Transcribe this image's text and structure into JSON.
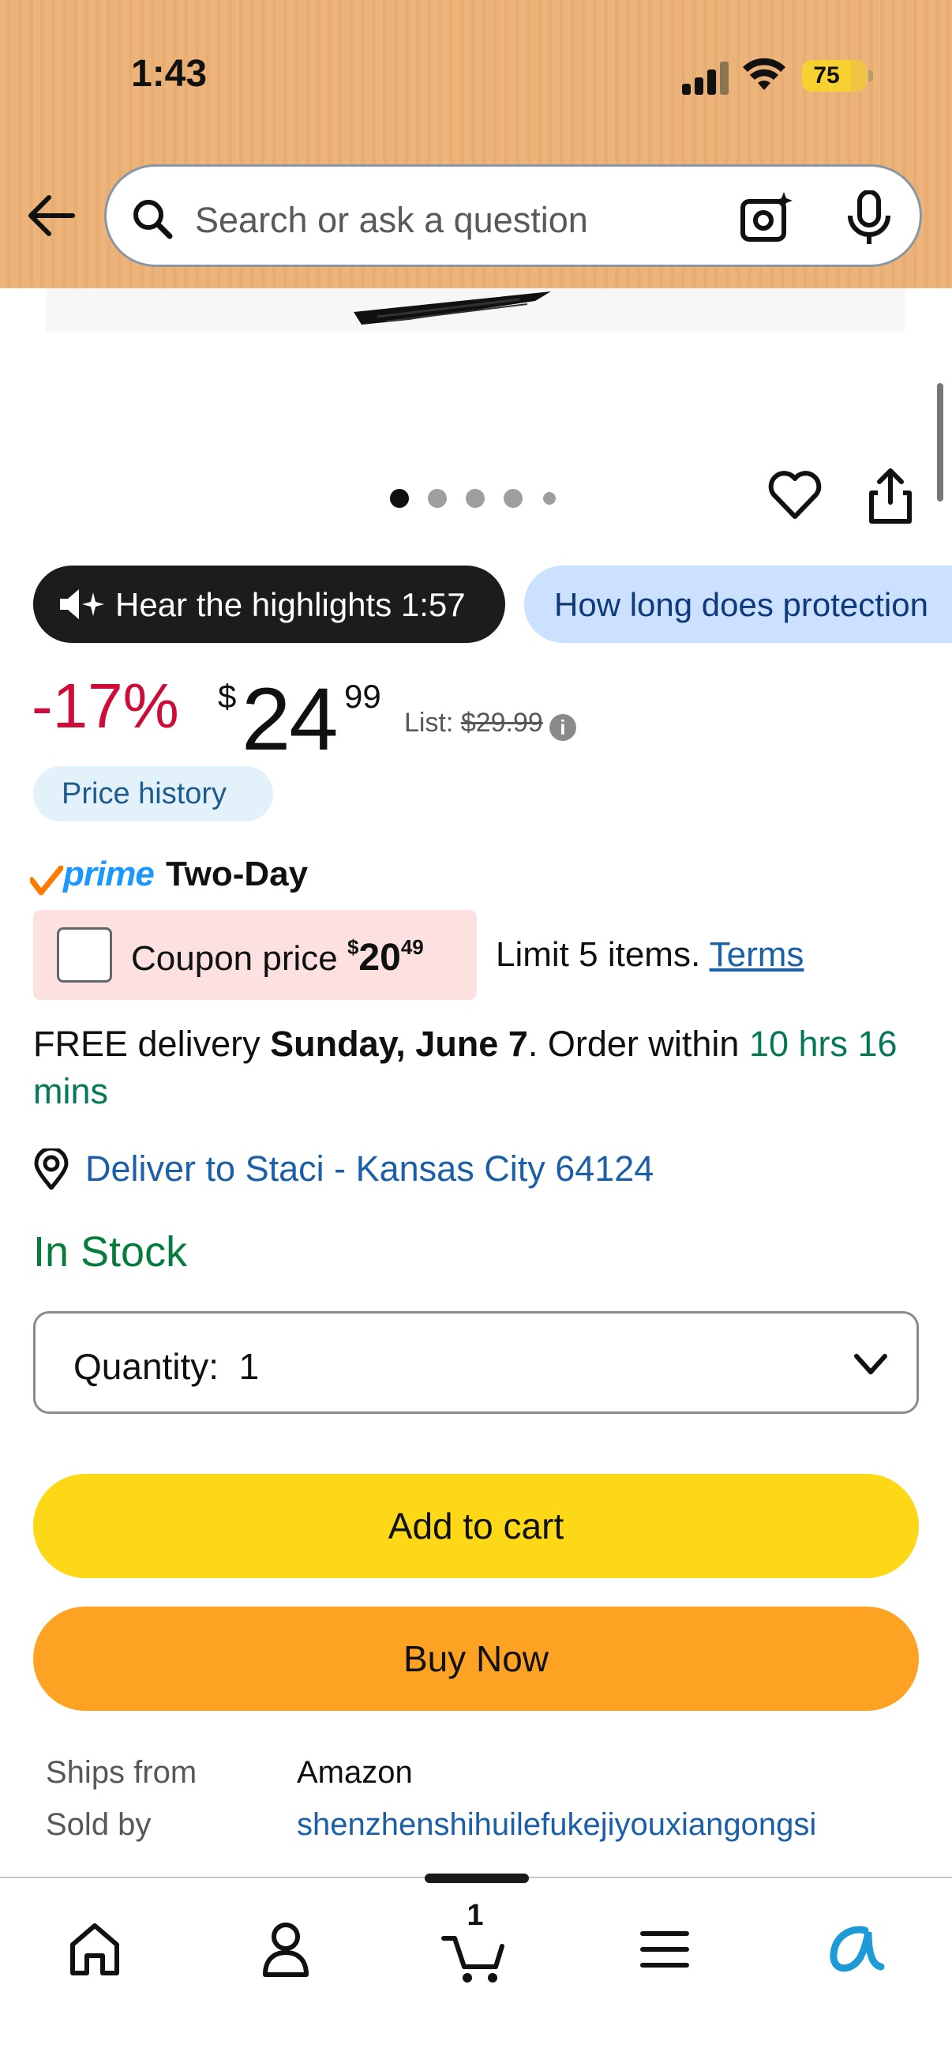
{
  "status_bar": {
    "time": "1:43",
    "battery": "75"
  },
  "search": {
    "placeholder": "Search or ask a question"
  },
  "gallery": {
    "dot_count": 5,
    "active_index": 0
  },
  "chips": {
    "hear": "Hear the highlights 1:57",
    "question": "How long does protection"
  },
  "price": {
    "discount": "-17%",
    "currency": "$",
    "whole": "24",
    "fraction": "99",
    "list_label": "List: ",
    "list_value": "$29.99"
  },
  "price_history": "Price history",
  "prime": {
    "word": "prime",
    "speed": "Two-Day"
  },
  "coupon": {
    "label": "Coupon price ",
    "currency": "$",
    "whole": "20",
    "fraction": "49",
    "limit": "Limit 5 items. ",
    "terms": "Terms"
  },
  "delivery": {
    "prefix": "FREE delivery ",
    "date": "Sunday, June 7",
    "middle": ". Order within ",
    "countdown": "10 hrs 16 mins"
  },
  "deliver_to": "Deliver to Staci - Kansas City 64124",
  "stock": "In Stock",
  "quantity": {
    "label": "Quantity:",
    "value": "1"
  },
  "buttons": {
    "add_to_cart": "Add to cart",
    "buy_now": "Buy Now"
  },
  "info": [
    {
      "key": "Ships from",
      "value": "Amazon"
    },
    {
      "key": "Sold by",
      "value": "shenzhenshihuilefukejiyouxiangongsi"
    }
  ],
  "tabbar": {
    "cart_count": "1"
  },
  "colors": {
    "header_bg": "#ecb37b",
    "discount": "#cc0c39",
    "link": "#1a5fa8",
    "in_stock": "#067d3e",
    "add_to_cart": "#fcd816",
    "buy_now": "#fda222",
    "prime_blue": "#1a98ff"
  }
}
